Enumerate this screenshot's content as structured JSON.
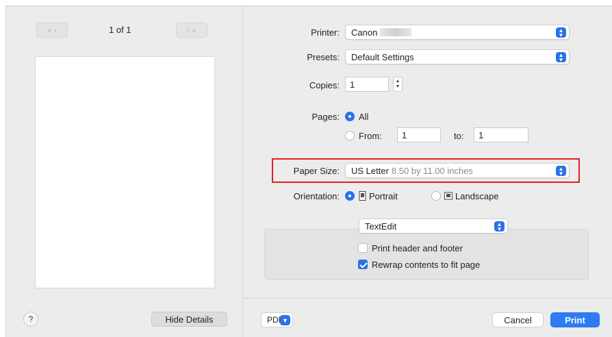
{
  "preview": {
    "prev_nav": [
      "«",
      "‹"
    ],
    "next_nav": [
      "›",
      "»"
    ],
    "page_indicator": "1 of 1"
  },
  "footer_left": {
    "help_label": "?",
    "hide_details_label": "Hide Details"
  },
  "printer": {
    "label": "Printer:",
    "value": "Canon"
  },
  "presets": {
    "label": "Presets:",
    "value": "Default Settings"
  },
  "copies": {
    "label": "Copies:",
    "value": "1"
  },
  "pages": {
    "label": "Pages:",
    "all_label": "All",
    "all_selected": true,
    "from_label": "From:",
    "from_value": "1",
    "to_label": "to:",
    "to_value": "1"
  },
  "paper_size": {
    "label": "Paper Size:",
    "value": "US Letter",
    "detail": "8.50 by 11.00 inches"
  },
  "orientation": {
    "label": "Orientation:",
    "portrait_label": "Portrait",
    "landscape_label": "Landscape",
    "selected": "Portrait"
  },
  "app_section": {
    "selected": "TextEdit",
    "print_header_footer": {
      "label": "Print header and footer",
      "checked": false
    },
    "rewrap": {
      "label": "Rewrap contents to fit page",
      "checked": true
    }
  },
  "bottom": {
    "pdf_label": "PDF",
    "cancel_label": "Cancel",
    "print_label": "Print"
  },
  "colors": {
    "accent": "#2a72e8",
    "highlight": "#e0201d",
    "background": "#ececec"
  }
}
